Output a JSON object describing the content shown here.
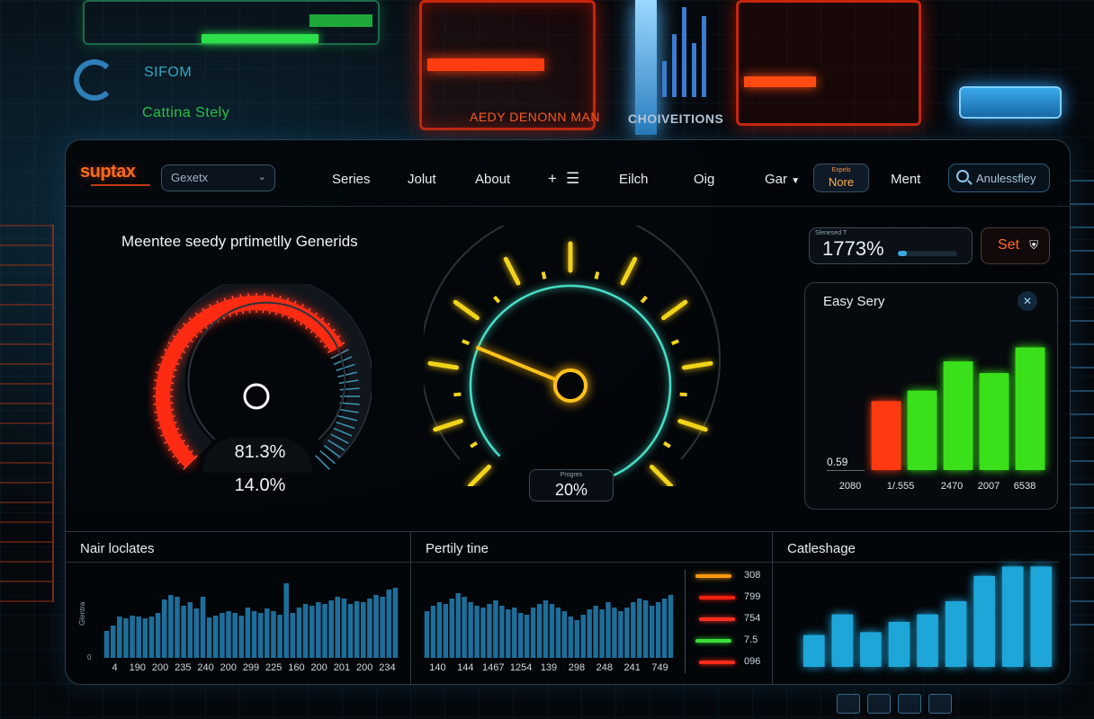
{
  "background": {
    "text1": "SIFOM",
    "text2": "Cattina Stely",
    "text3": "AEDY DENONN MAN",
    "text4": "CHOIVEITIONS"
  },
  "navbar": {
    "brand": "suptax",
    "select_value": "Gexetx",
    "items": [
      "Series",
      "Jolut",
      "About",
      "Eilch",
      "Oig"
    ],
    "icons": [
      "plus-icon",
      "menu-icon"
    ],
    "dropdown_label": "Gar",
    "badge_top": "Expels",
    "badge_label": "Nore",
    "ment_label": "Ment",
    "search_text": "Anulessfley"
  },
  "main": {
    "headline": "Meentee seedy prtimetlly Generids"
  },
  "gauge_left": {
    "value1": "81.3%",
    "value2": "14.0%",
    "level": 0.72,
    "colors": {
      "arc": "#ff2a12",
      "ticks": "#3c96b4",
      "ring": "#2e3a44"
    }
  },
  "gauge_center": {
    "label": "Progres",
    "value": "20%",
    "colors": {
      "ticks": "#f0d41a",
      "ring": "#48e0c8",
      "needle": "#ffc21a"
    }
  },
  "stat": {
    "label": "Slenesed T",
    "value": "1773%",
    "progress": 0.15
  },
  "set_button": {
    "label": "Set",
    "icon": "shield-icon"
  },
  "bar_panel": {
    "title": "Easy Sery",
    "close_icon": "close-icon",
    "y_label": "0.59"
  },
  "bottom": {
    "panel1_title": "Nair loclates",
    "panel1_side_label": "Glentra",
    "panel1_zero": "0",
    "panel2_title": "Pertily tine",
    "panel3_title": "Catleshage",
    "legend": [
      {
        "value": "308",
        "color": "#ff9a10"
      },
      {
        "value": "799",
        "color": "#ff2010"
      },
      {
        "value": "754",
        "color": "#ff3020"
      },
      {
        "value": "7.5",
        "color": "#3ae03a"
      },
      {
        "value": "096",
        "color": "#ff2a18"
      }
    ]
  },
  "chart_data": [
    {
      "type": "bar",
      "title": "Easy Sery",
      "categories": [
        "2080",
        "1/.555",
        "2470",
        "2007",
        "6538"
      ],
      "values": [
        0.59,
        0.68,
        0.93,
        0.83,
        1.05
      ],
      "colors": [
        "#ff3a10",
        "#3ae01a",
        "#3ae01a",
        "#3ae01a",
        "#3ae01a"
      ],
      "ylim": [
        0,
        1.2
      ],
      "grid": false
    },
    {
      "type": "bar",
      "title": "Nair loclates",
      "ylabel": "Glentra",
      "categories": [
        "4",
        "190",
        "200",
        "235",
        "240",
        "200",
        "299",
        "225",
        "160",
        "200",
        "201",
        "200",
        "234"
      ],
      "values": [
        30,
        36,
        46,
        44,
        47,
        46,
        44,
        46,
        50,
        65,
        70,
        68,
        58,
        62,
        55,
        68,
        45,
        47,
        50,
        52,
        50,
        47,
        56,
        52,
        50,
        55,
        52,
        48,
        83,
        50,
        56,
        60,
        58,
        62,
        60,
        64,
        68,
        66,
        60,
        63,
        62,
        66,
        70,
        68,
        76,
        78
      ],
      "ylim": [
        0,
        100
      ],
      "color": "#1e6e9a",
      "grid": false
    },
    {
      "type": "bar",
      "title": "Pertily tine",
      "categories": [
        "140",
        "144",
        "1467",
        "1254",
        "139",
        "298",
        "248",
        "241",
        "749"
      ],
      "values": [
        52,
        58,
        62,
        60,
        66,
        72,
        68,
        62,
        58,
        56,
        60,
        64,
        58,
        54,
        56,
        50,
        48,
        56,
        60,
        64,
        60,
        56,
        52,
        46,
        42,
        48,
        54,
        58,
        54,
        62,
        56,
        52,
        56,
        62,
        66,
        64,
        58,
        62,
        66,
        70
      ],
      "ylim": [
        0,
        100
      ],
      "color": "#1e6e9a",
      "grid": false
    },
    {
      "type": "bar",
      "title": "Catleshage",
      "categories": [
        "",
        "",
        "",
        "",
        "",
        "",
        "",
        "",
        "",
        ""
      ],
      "values": [
        34,
        56,
        37,
        48,
        56,
        70,
        97,
        107,
        107
      ],
      "ylim": [
        0,
        115
      ],
      "color": "#1ea6d8",
      "grid": false
    }
  ]
}
